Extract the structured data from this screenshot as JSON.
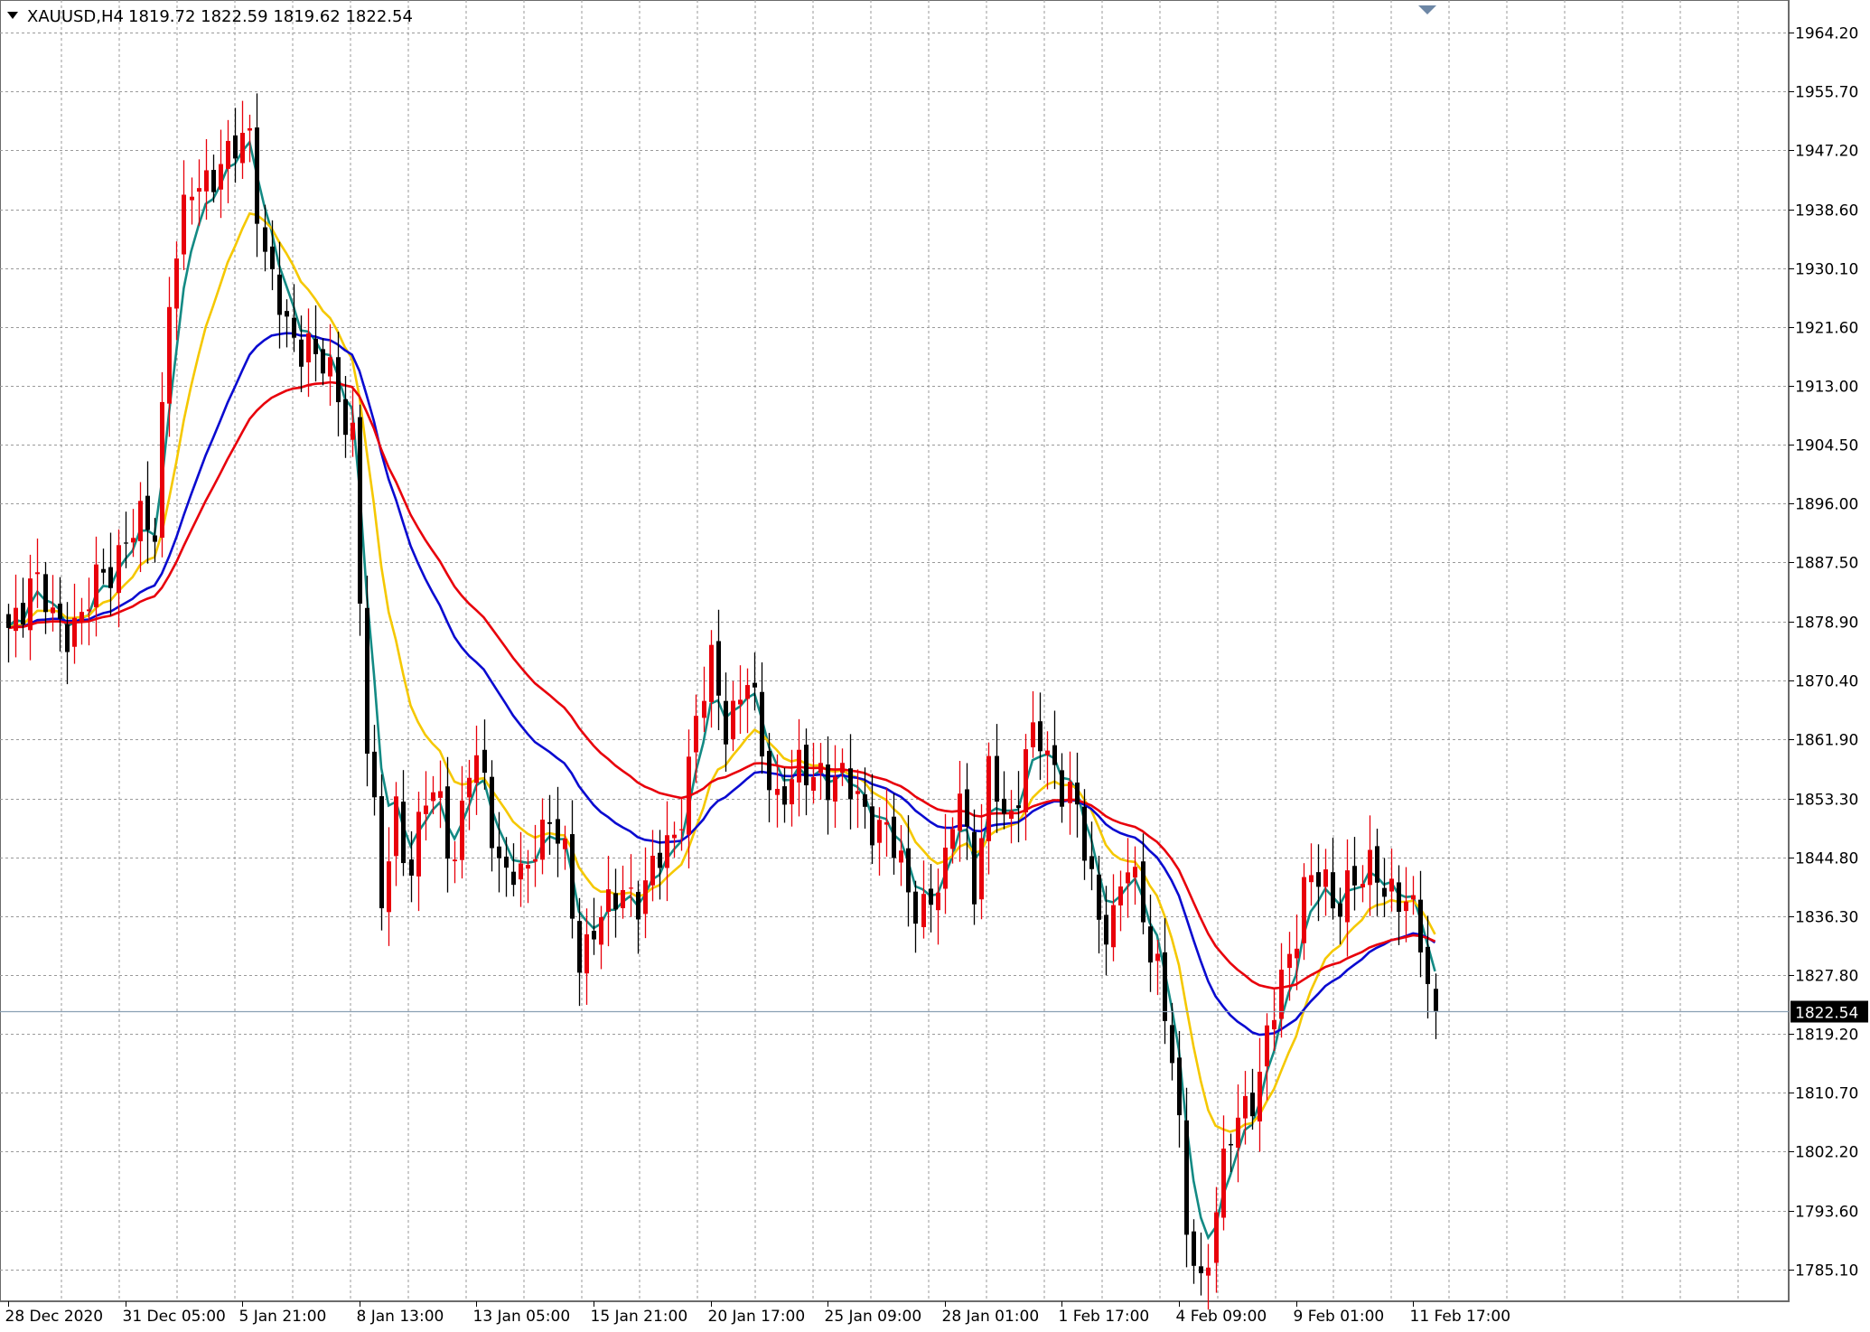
{
  "header": {
    "menu_icon": "triangle-down-icon",
    "symbol": "XAUUSD,H4",
    "ohlc": "1819.72 1822.59 1819.62 1822.54"
  },
  "chart_data": {
    "type": "candlestick",
    "symbol": "XAUUSD",
    "timeframe": "H4",
    "ylim": [
      1783,
      1968
    ],
    "grid": true,
    "y_ticks": [
      1964.2,
      1955.7,
      1947.2,
      1938.6,
      1930.1,
      1921.6,
      1913.0,
      1904.5,
      1896.0,
      1887.5,
      1878.9,
      1870.4,
      1861.9,
      1853.3,
      1844.8,
      1836.3,
      1827.8,
      1819.2,
      1810.7,
      1802.2,
      1793.6,
      1785.1
    ],
    "y_tick_labels": [
      "1964.20",
      "1955.70",
      "1947.20",
      "1938.60",
      "1930.10",
      "1921.60",
      "1913.00",
      "1904.50",
      "1896.00",
      "1887.50",
      "1878.90",
      "1870.40",
      "1861.90",
      "1853.30",
      "1844.80",
      "1836.30",
      "1827.80",
      "1819.20",
      "1810.70",
      "1802.20",
      "1793.60",
      "1785.10"
    ],
    "x_tick_labels": [
      {
        "bar": 0,
        "label": "28 Dec 2020"
      },
      {
        "bar": 16,
        "label": "31 Dec 05:00"
      },
      {
        "bar": 32,
        "label": "5 Jan 21:00"
      },
      {
        "bar": 48,
        "label": "8 Jan 13:00"
      },
      {
        "bar": 64,
        "label": "13 Jan 05:00"
      },
      {
        "bar": 80,
        "label": "15 Jan 21:00"
      },
      {
        "bar": 96,
        "label": "20 Jan 17:00"
      },
      {
        "bar": 112,
        "label": "25 Jan 09:00"
      },
      {
        "bar": 128,
        "label": "28 Jan 01:00"
      },
      {
        "bar": 144,
        "label": "1 Feb 17:00"
      },
      {
        "bar": 160,
        "label": "4 Feb 09:00"
      },
      {
        "bar": 176,
        "label": "9 Feb 01:00"
      },
      {
        "bar": 192,
        "label": "11 Feb 17:00"
      }
    ],
    "current_price": 1822.54,
    "current_price_label": "1822.54",
    "colors": {
      "bull": "#e8000b",
      "bear": "#000000",
      "ma_fast": "#138a84",
      "ma_mid": "#f5c800",
      "ma_slow": "#0a0ad0",
      "ma_long": "#e8000b",
      "grid": "#9a9a9a",
      "current_line": "#8aa0b4"
    },
    "anchors": [
      [
        0,
        1878
      ],
      [
        3,
        1885
      ],
      [
        6,
        1879
      ],
      [
        10,
        1879
      ],
      [
        13,
        1886
      ],
      [
        16,
        1891
      ],
      [
        20,
        1893
      ],
      [
        22,
        1927
      ],
      [
        25,
        1941
      ],
      [
        28,
        1945
      ],
      [
        30,
        1945
      ],
      [
        33,
        1950
      ],
      [
        35,
        1932
      ],
      [
        38,
        1920
      ],
      [
        41,
        1920
      ],
      [
        44,
        1913
      ],
      [
        47,
        1907
      ],
      [
        49,
        1860
      ],
      [
        51,
        1838
      ],
      [
        53,
        1853
      ],
      [
        55,
        1842
      ],
      [
        57,
        1853
      ],
      [
        59,
        1854
      ],
      [
        61,
        1844
      ],
      [
        63,
        1857
      ],
      [
        65,
        1857
      ],
      [
        67,
        1844
      ],
      [
        70,
        1840
      ],
      [
        72,
        1848
      ],
      [
        74,
        1851
      ],
      [
        76,
        1843
      ],
      [
        78,
        1830
      ],
      [
        80,
        1836
      ],
      [
        82,
        1836
      ],
      [
        84,
        1840
      ],
      [
        86,
        1840
      ],
      [
        88,
        1842
      ],
      [
        91,
        1848
      ],
      [
        94,
        1864
      ],
      [
        96,
        1872
      ],
      [
        98,
        1865
      ],
      [
        101,
        1870
      ],
      [
        103,
        1860
      ],
      [
        105,
        1854
      ],
      [
        107,
        1856
      ],
      [
        109,
        1856
      ],
      [
        111,
        1858
      ],
      [
        113,
        1856
      ],
      [
        115,
        1854
      ],
      [
        118,
        1851
      ],
      [
        120,
        1848
      ],
      [
        123,
        1840
      ],
      [
        126,
        1838
      ],
      [
        128,
        1842
      ],
      [
        130,
        1857
      ],
      [
        132,
        1840
      ],
      [
        134,
        1855
      ],
      [
        137,
        1851
      ],
      [
        139,
        1860
      ],
      [
        141,
        1861
      ],
      [
        143,
        1858
      ],
      [
        145,
        1855
      ],
      [
        147,
        1845
      ],
      [
        149,
        1836
      ],
      [
        151,
        1837
      ],
      [
        153,
        1843
      ],
      [
        155,
        1836
      ],
      [
        157,
        1830
      ],
      [
        159,
        1815
      ],
      [
        161,
        1791
      ],
      [
        163,
        1784
      ],
      [
        165,
        1793
      ],
      [
        167,
        1804
      ],
      [
        169,
        1810
      ],
      [
        171,
        1813
      ],
      [
        173,
        1822
      ],
      [
        175,
        1831
      ],
      [
        177,
        1841
      ],
      [
        179,
        1841
      ],
      [
        181,
        1838
      ],
      [
        183,
        1842
      ],
      [
        185,
        1841
      ],
      [
        187,
        1842
      ],
      [
        189,
        1841
      ],
      [
        191,
        1838
      ],
      [
        193,
        1832
      ],
      [
        195,
        1822
      ]
    ]
  }
}
